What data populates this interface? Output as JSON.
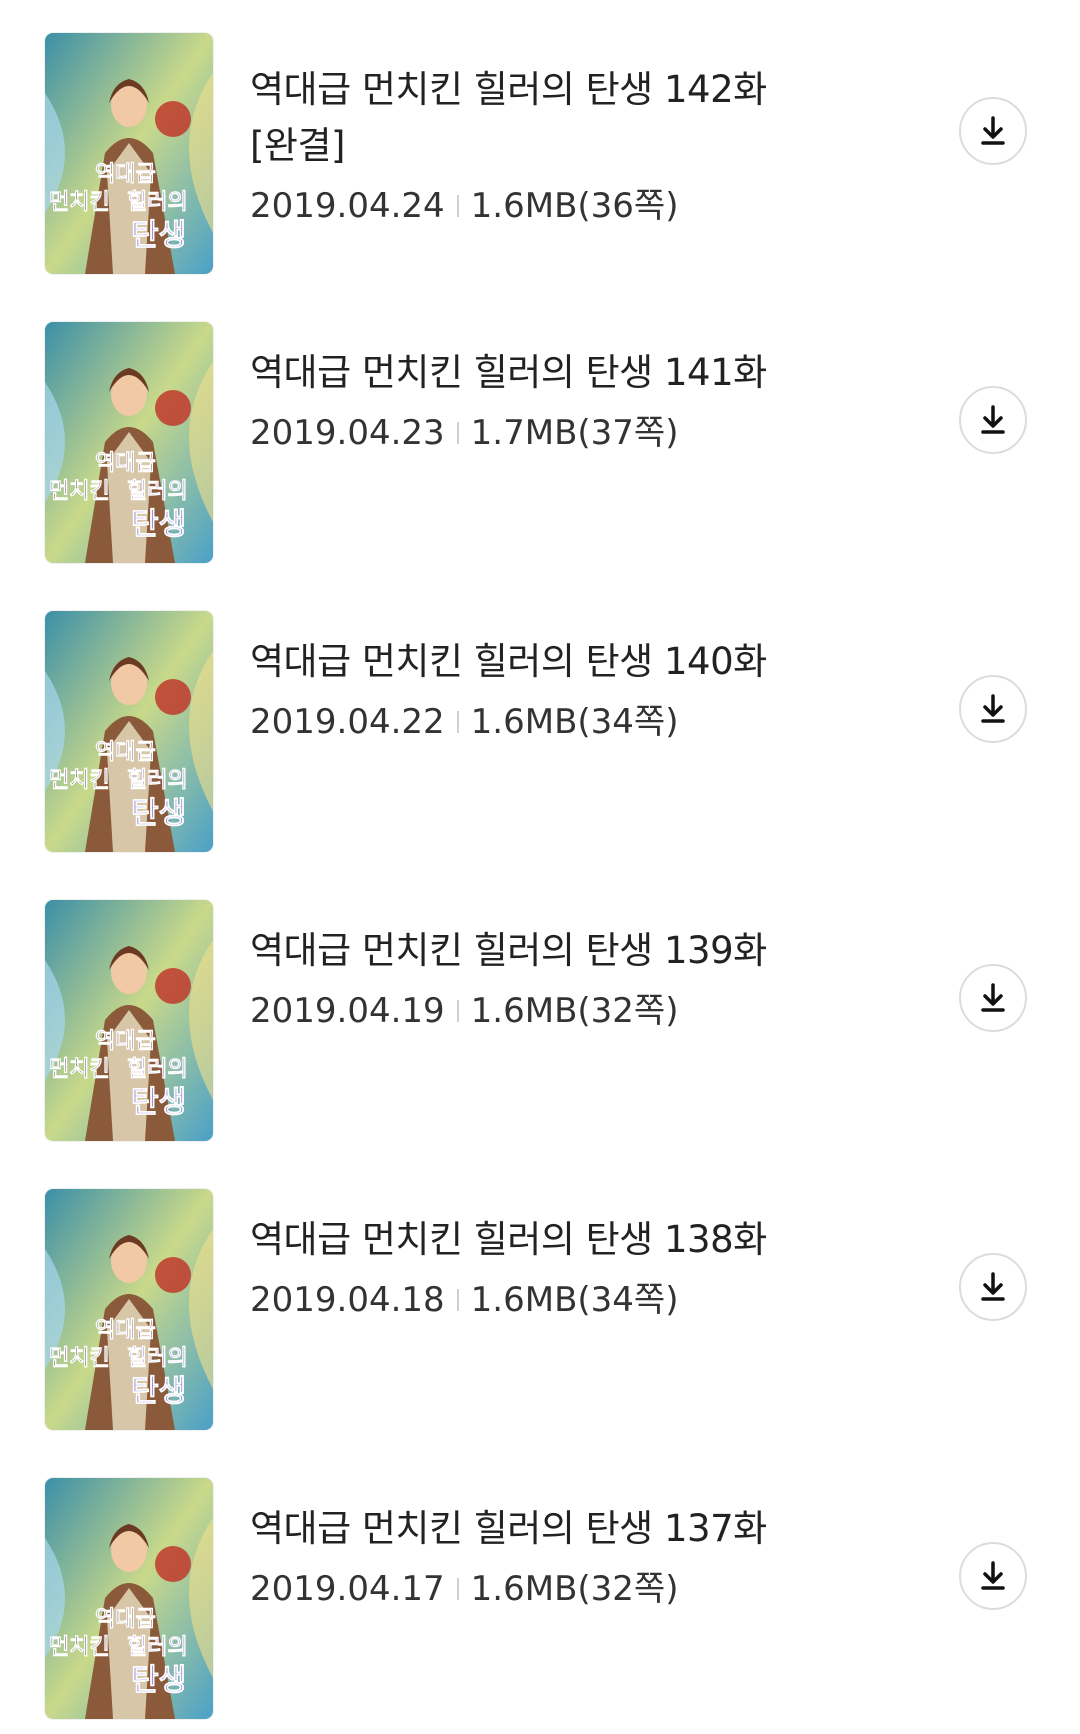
{
  "episodes": [
    {
      "title": "역대급 먼치킨 힐러의 탄생 142화 [완결]",
      "date": "2019.04.24",
      "size": "1.6MB(36쪽)"
    },
    {
      "title": "역대급 먼치킨 힐러의 탄생 141화",
      "date": "2019.04.23",
      "size": "1.7MB(37쪽)"
    },
    {
      "title": "역대급 먼치킨 힐러의 탄생 140화",
      "date": "2019.04.22",
      "size": "1.6MB(34쪽)"
    },
    {
      "title": "역대급 먼치킨 힐러의 탄생 139화",
      "date": "2019.04.19",
      "size": "1.6MB(32쪽)"
    },
    {
      "title": "역대급 먼치킨 힐러의 탄생 138화",
      "date": "2019.04.18",
      "size": "1.6MB(34쪽)"
    },
    {
      "title": "역대급 먼치킨 힐러의 탄생 137화",
      "date": "2019.04.17",
      "size": "1.6MB(32쪽)"
    }
  ],
  "cover_text": {
    "line1": "역대급",
    "line2a": "먼치킨",
    "line2b": "힐러의",
    "line3": "탄생"
  },
  "icons": {
    "download": "download-arrow-icon"
  }
}
